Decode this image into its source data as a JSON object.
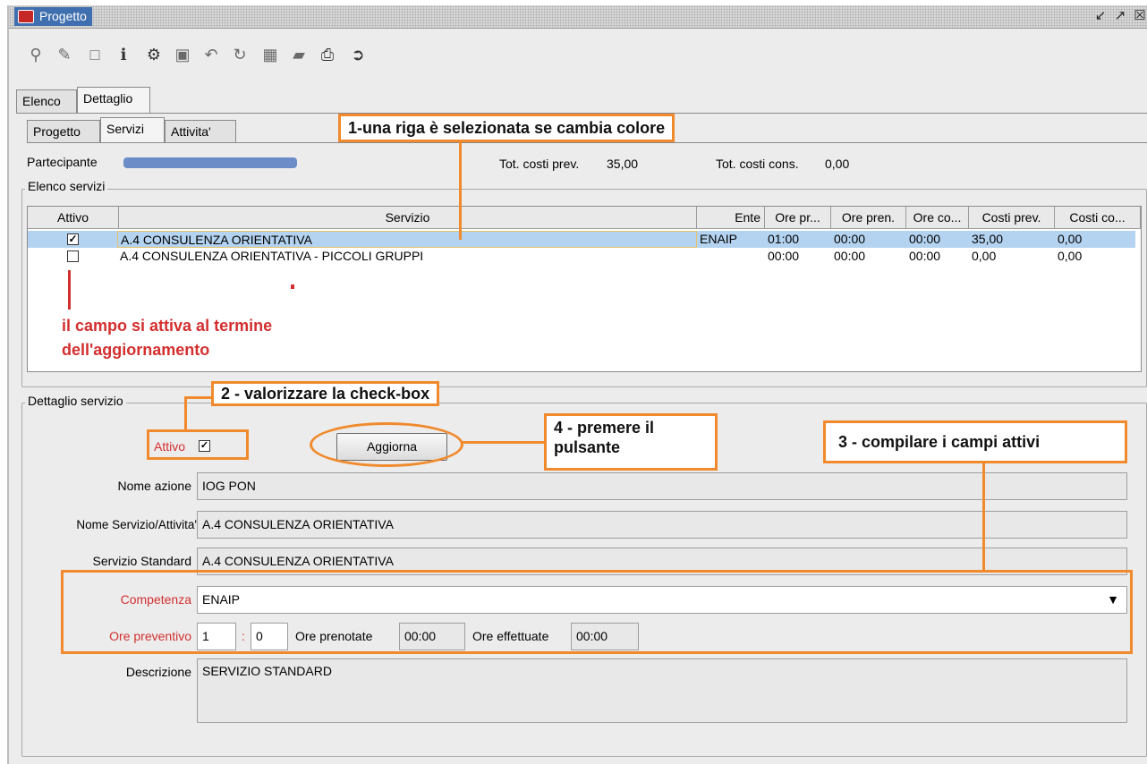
{
  "window": {
    "title": "Progetto",
    "controls": [
      "restore-icon",
      "maximize-icon",
      "close-icon"
    ]
  },
  "toolbar": {
    "icons": [
      "search-icon",
      "edit-icon",
      "new-document-icon",
      "info-icon",
      "configure-icon",
      "save-icon",
      "undo-icon",
      "refresh-icon",
      "grid-icon",
      "folder-icon",
      "print-icon",
      "exit-icon"
    ]
  },
  "tabs_main": [
    "Elenco",
    "Dettaglio"
  ],
  "tabs_sub": [
    "Progetto",
    "Servizi",
    "Attivita'"
  ],
  "summary": {
    "partecipante_label": "Partecipante",
    "tot_prev_label": "Tot. costi prev.",
    "tot_prev_value": "35,00",
    "tot_cons_label": "Tot. costi cons.",
    "tot_cons_value": "0,00"
  },
  "elenco": {
    "title": "Elenco servizi",
    "columns": [
      "Attivo",
      "Servizio",
      "Ente",
      "Ore pr...",
      "Ore pren.",
      "Ore co...",
      "Costi prev.",
      "Costi co..."
    ],
    "rows": [
      {
        "attivo": true,
        "servizio": "A.4 CONSULENZA ORIENTATIVA",
        "ente": "ENAIP",
        "ore_prev": "01:00",
        "ore_pren": "00:00",
        "ore_cons": "00:00",
        "costi_prev": "35,00",
        "costi_cons": "0,00"
      },
      {
        "attivo": false,
        "servizio": "A.4 CONSULENZA ORIENTATIVA - PICCOLI GRUPPI",
        "ente": "",
        "ore_prev": "00:00",
        "ore_pren": "00:00",
        "ore_cons": "00:00",
        "costi_prev": "0,00",
        "costi_cons": "0,00"
      }
    ]
  },
  "dettaglio": {
    "title": "Dettaglio servizio",
    "attivo_label": "Attivo",
    "aggiorna_label": "Aggiorna",
    "nome_azione_label": "Nome azione",
    "nome_azione_value": "IOG PON",
    "nome_servizio_label": "Nome Servizio/Attivita'",
    "nome_servizio_value": "A.4 CONSULENZA ORIENTATIVA",
    "servizio_std_label": "Servizio Standard",
    "servizio_std_value": "A.4 CONSULENZA ORIENTATIVA",
    "competenza_label": "Competenza",
    "competenza_value": "ENAIP",
    "ore_prev_label": "Ore preventivo",
    "ore_prev_hours": "1",
    "ore_prev_sep": ":",
    "ore_prev_minutes": "0",
    "ore_pren_label": "Ore prenotate",
    "ore_pren_value": "00:00",
    "ore_eff_label": "Ore effettuate",
    "ore_eff_value": "00:00",
    "descrizione_label": "Descrizione",
    "descrizione_value": "SERVIZIO STANDARD"
  },
  "annotations": {
    "a1": "1-una riga è selezionata se cambia colore",
    "a2": "2 - valorizzare la check-box",
    "a3": "3 - compilare i campi attivi",
    "a4_line1": "4 - premere il",
    "a4_line2": "pulsante",
    "red_note_line1": "il campo si attiva al termine",
    "red_note_line2": "dell'aggiornamento"
  },
  "colors": {
    "selected_row": "#b4d3f0",
    "annotation_orange": "#f08a2c",
    "annotation_red": "#d32f2f",
    "title_highlight": "#3f6fae"
  }
}
